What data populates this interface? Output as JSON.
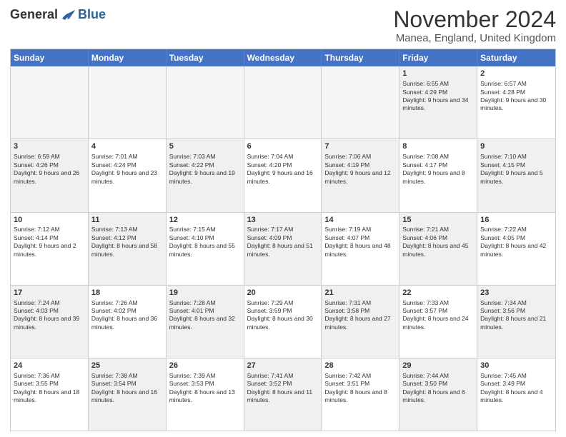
{
  "logo": {
    "general": "General",
    "blue": "Blue"
  },
  "title": "November 2024",
  "subtitle": "Manea, England, United Kingdom",
  "header_days": [
    "Sunday",
    "Monday",
    "Tuesday",
    "Wednesday",
    "Thursday",
    "Friday",
    "Saturday"
  ],
  "rows": [
    [
      {
        "day": "",
        "text": "",
        "empty": true
      },
      {
        "day": "",
        "text": "",
        "empty": true
      },
      {
        "day": "",
        "text": "",
        "empty": true
      },
      {
        "day": "",
        "text": "",
        "empty": true
      },
      {
        "day": "",
        "text": "",
        "empty": true
      },
      {
        "day": "1",
        "text": "Sunrise: 6:55 AM\nSunset: 4:29 PM\nDaylight: 9 hours and 34 minutes.",
        "shaded": true
      },
      {
        "day": "2",
        "text": "Sunrise: 6:57 AM\nSunset: 4:28 PM\nDaylight: 9 hours and 30 minutes.",
        "shaded": false
      }
    ],
    [
      {
        "day": "3",
        "text": "Sunrise: 6:59 AM\nSunset: 4:26 PM\nDaylight: 9 hours and 26 minutes.",
        "shaded": true
      },
      {
        "day": "4",
        "text": "Sunrise: 7:01 AM\nSunset: 4:24 PM\nDaylight: 9 hours and 23 minutes.",
        "shaded": false
      },
      {
        "day": "5",
        "text": "Sunrise: 7:03 AM\nSunset: 4:22 PM\nDaylight: 9 hours and 19 minutes.",
        "shaded": true
      },
      {
        "day": "6",
        "text": "Sunrise: 7:04 AM\nSunset: 4:20 PM\nDaylight: 9 hours and 16 minutes.",
        "shaded": false
      },
      {
        "day": "7",
        "text": "Sunrise: 7:06 AM\nSunset: 4:19 PM\nDaylight: 9 hours and 12 minutes.",
        "shaded": true
      },
      {
        "day": "8",
        "text": "Sunrise: 7:08 AM\nSunset: 4:17 PM\nDaylight: 9 hours and 8 minutes.",
        "shaded": false
      },
      {
        "day": "9",
        "text": "Sunrise: 7:10 AM\nSunset: 4:15 PM\nDaylight: 9 hours and 5 minutes.",
        "shaded": true
      }
    ],
    [
      {
        "day": "10",
        "text": "Sunrise: 7:12 AM\nSunset: 4:14 PM\nDaylight: 9 hours and 2 minutes.",
        "shaded": false
      },
      {
        "day": "11",
        "text": "Sunrise: 7:13 AM\nSunset: 4:12 PM\nDaylight: 8 hours and 58 minutes.",
        "shaded": true
      },
      {
        "day": "12",
        "text": "Sunrise: 7:15 AM\nSunset: 4:10 PM\nDaylight: 8 hours and 55 minutes.",
        "shaded": false
      },
      {
        "day": "13",
        "text": "Sunrise: 7:17 AM\nSunset: 4:09 PM\nDaylight: 8 hours and 51 minutes.",
        "shaded": true
      },
      {
        "day": "14",
        "text": "Sunrise: 7:19 AM\nSunset: 4:07 PM\nDaylight: 8 hours and 48 minutes.",
        "shaded": false
      },
      {
        "day": "15",
        "text": "Sunrise: 7:21 AM\nSunset: 4:06 PM\nDaylight: 8 hours and 45 minutes.",
        "shaded": true
      },
      {
        "day": "16",
        "text": "Sunrise: 7:22 AM\nSunset: 4:05 PM\nDaylight: 8 hours and 42 minutes.",
        "shaded": false
      }
    ],
    [
      {
        "day": "17",
        "text": "Sunrise: 7:24 AM\nSunset: 4:03 PM\nDaylight: 8 hours and 39 minutes.",
        "shaded": true
      },
      {
        "day": "18",
        "text": "Sunrise: 7:26 AM\nSunset: 4:02 PM\nDaylight: 8 hours and 36 minutes.",
        "shaded": false
      },
      {
        "day": "19",
        "text": "Sunrise: 7:28 AM\nSunset: 4:01 PM\nDaylight: 8 hours and 32 minutes.",
        "shaded": true
      },
      {
        "day": "20",
        "text": "Sunrise: 7:29 AM\nSunset: 3:59 PM\nDaylight: 8 hours and 30 minutes.",
        "shaded": false
      },
      {
        "day": "21",
        "text": "Sunrise: 7:31 AM\nSunset: 3:58 PM\nDaylight: 8 hours and 27 minutes.",
        "shaded": true
      },
      {
        "day": "22",
        "text": "Sunrise: 7:33 AM\nSunset: 3:57 PM\nDaylight: 8 hours and 24 minutes.",
        "shaded": false
      },
      {
        "day": "23",
        "text": "Sunrise: 7:34 AM\nSunset: 3:56 PM\nDaylight: 8 hours and 21 minutes.",
        "shaded": true
      }
    ],
    [
      {
        "day": "24",
        "text": "Sunrise: 7:36 AM\nSunset: 3:55 PM\nDaylight: 8 hours and 18 minutes.",
        "shaded": false
      },
      {
        "day": "25",
        "text": "Sunrise: 7:38 AM\nSunset: 3:54 PM\nDaylight: 8 hours and 16 minutes.",
        "shaded": true
      },
      {
        "day": "26",
        "text": "Sunrise: 7:39 AM\nSunset: 3:53 PM\nDaylight: 8 hours and 13 minutes.",
        "shaded": false
      },
      {
        "day": "27",
        "text": "Sunrise: 7:41 AM\nSunset: 3:52 PM\nDaylight: 8 hours and 11 minutes.",
        "shaded": true
      },
      {
        "day": "28",
        "text": "Sunrise: 7:42 AM\nSunset: 3:51 PM\nDaylight: 8 hours and 8 minutes.",
        "shaded": false
      },
      {
        "day": "29",
        "text": "Sunrise: 7:44 AM\nSunset: 3:50 PM\nDaylight: 8 hours and 6 minutes.",
        "shaded": true
      },
      {
        "day": "30",
        "text": "Sunrise: 7:45 AM\nSunset: 3:49 PM\nDaylight: 8 hours and 4 minutes.",
        "shaded": false
      }
    ]
  ]
}
